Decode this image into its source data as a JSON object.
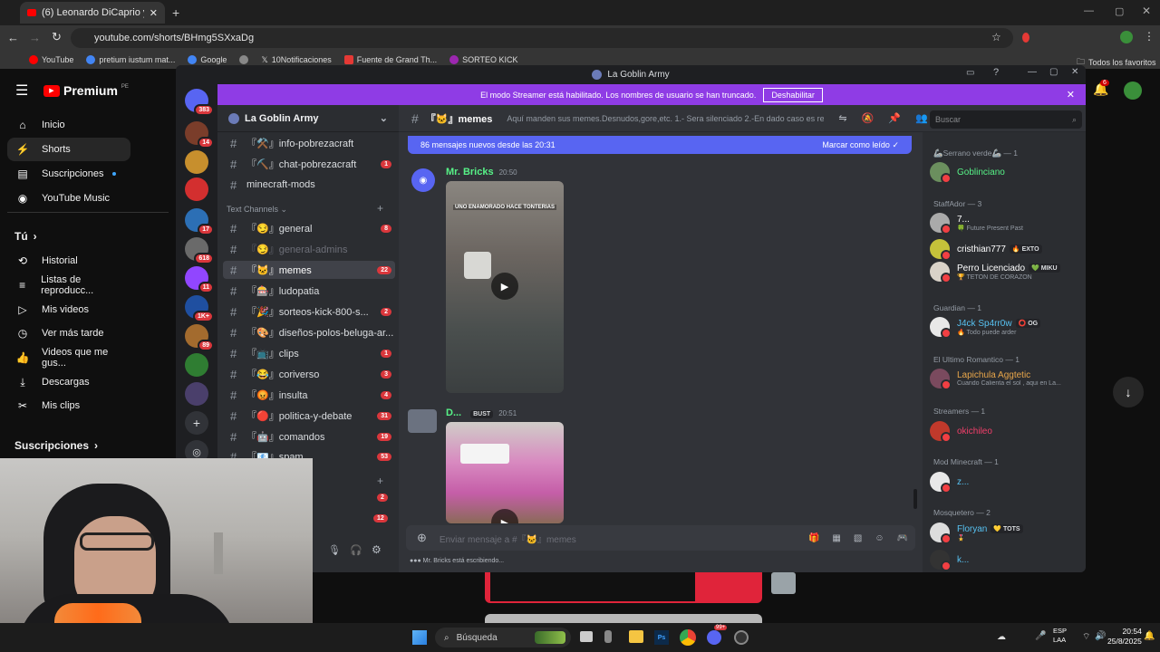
{
  "browser": {
    "tab_title": "(6) Leonardo DiCaprio y su lim...",
    "url": "youtube.com/shorts/BHmg5SXxaDg",
    "bookmarks": [
      "YouTube",
      "pretium iustum mat...",
      "Google",
      "",
      "10Notificaciones",
      "Fuente de Grand Th...",
      "SORTEO KICK"
    ],
    "all_favorites": "Todos los favoritos"
  },
  "youtube": {
    "logo": "Premium",
    "logo_sup": "PE",
    "nav": [
      "Inicio",
      "Shorts",
      "Suscripciones",
      "YouTube Music"
    ],
    "you_header": "Tú",
    "you_items": [
      "Historial",
      "Listas de reproducc...",
      "Mis videos",
      "Ver más tarde",
      "Videos que me gus...",
      "Descargas",
      "Mis clips"
    ],
    "subs_header": "Suscripciones"
  },
  "discord": {
    "window_title": "La Goblin Army",
    "streamer_banner": "El modo Streamer está habilitado. Los nombres de usuario se han truncado.",
    "streamer_button": "Deshabilitar",
    "server_name": "La Goblin Army",
    "server_badges": [
      "383",
      "14",
      "",
      "",
      "17",
      "618",
      "11",
      "1K+",
      "89",
      "",
      ""
    ],
    "channels": [
      {
        "name": "『⚒️』info-pobrezacraft",
        "badge": ""
      },
      {
        "name": "『⛏️』chat-pobrezacraft",
        "badge": "1"
      },
      {
        "name": "minecraft-mods",
        "badge": ""
      }
    ],
    "category": "Text Channels",
    "text_channels": [
      {
        "name": "『😏』general",
        "badge": "8"
      },
      {
        "name": "『😏』general-admins",
        "badge": ""
      },
      {
        "name": "『🐱』memes",
        "badge": "22"
      },
      {
        "name": "『🎰』ludopatia",
        "badge": ""
      },
      {
        "name": "『🎉』sorteos-kick-800-s...",
        "badge": "2"
      },
      {
        "name": "『🎨』diseños-polos-beluga-ar...",
        "badge": ""
      },
      {
        "name": "『📺』clips",
        "badge": "1"
      },
      {
        "name": "『😂』coriverso",
        "badge": "3"
      },
      {
        "name": "『😡』insulta",
        "badge": "4"
      },
      {
        "name": "『🔴』politica-y-debate",
        "badge": "31"
      },
      {
        "name": "『🤖』comandos",
        "badge": "19"
      },
      {
        "name": "『📧』spam",
        "badge": "53"
      }
    ],
    "extra_badges": [
      "2",
      "12"
    ],
    "chat_channel": "『🐱』memes",
    "chat_topic": "Aquí manden sus memes.Desnudos,gore,etc. 1.- Sera silenciado 2.-En dado caso es rei...",
    "search_placeholder": "Buscar",
    "new_messages": "86 mensajes nuevos desde las 20:31",
    "mark_read": "Marcar como leído",
    "messages": [
      {
        "author": "Mr. Bricks",
        "time": "20:50",
        "video_caption": "UNO ENAMORADO HACE TONTERIAS"
      },
      {
        "author": "D...",
        "role_tag": "BUST",
        "time": "20:51"
      }
    ],
    "input_placeholder": "Enviar mensaje a #『🐱』memes",
    "typing": "Mr. Bricks está escribiendo...",
    "members": [
      {
        "group": "🦾Serrano verde🦾 — 1",
        "name": "Goblinciano",
        "sub": "",
        "tag": "",
        "color": "#57f287"
      },
      {
        "group": "StaffAdor — 3",
        "name": "7...",
        "sub": "🍀 Future Present Past",
        "tag": "",
        "color": "#ffffff"
      },
      {
        "group": "",
        "name": "cristhian777",
        "sub": "",
        "tag": "🔥 EXTO",
        "color": "#ffffff"
      },
      {
        "group": "",
        "name": "Perro Licenciado",
        "sub": "🏆 TETON DE CORAZON",
        "tag": "💚 MIKU",
        "color": "#ffffff"
      },
      {
        "group": "Guardian — 1",
        "name": "J4ck Sp4rr0w",
        "sub": "🔥 Todo puede arder",
        "tag": "⭕ OG",
        "color": "#57c2f2"
      },
      {
        "group": "El Ultimo Romantico — 1",
        "name": "Lapichula Aggtetic",
        "sub": "Cuando Calienta el sol , aqui en La...",
        "tag": "",
        "color": "#e8a64a"
      },
      {
        "group": "Streamers — 1",
        "name": "okichileo",
        "sub": "",
        "tag": "",
        "color": "#f23f6a"
      },
      {
        "group": "Mod Minecraft — 1",
        "name": "z...",
        "sub": "",
        "tag": "",
        "color": "#57c2f2"
      },
      {
        "group": "Mosquetero — 2",
        "name": "Floryan",
        "sub": "🎖️",
        "tag": "💛 TOTS",
        "color": "#57c2f2"
      },
      {
        "group": "",
        "name": "k...",
        "sub": "",
        "tag": "",
        "color": "#57c2f2"
      }
    ],
    "notif_badge": "6"
  },
  "taskbar": {
    "search": "Búsqueda",
    "lang1": "ESP",
    "lang2": "LAA",
    "time": "20:54",
    "date": "25/8/2025",
    "discord_badge": "99+"
  },
  "colors": {
    "discord_accent": "#5865f2",
    "streamer_purple": "#8f3ce5",
    "badge_red": "#da373c",
    "yt_red": "#ff0000"
  }
}
